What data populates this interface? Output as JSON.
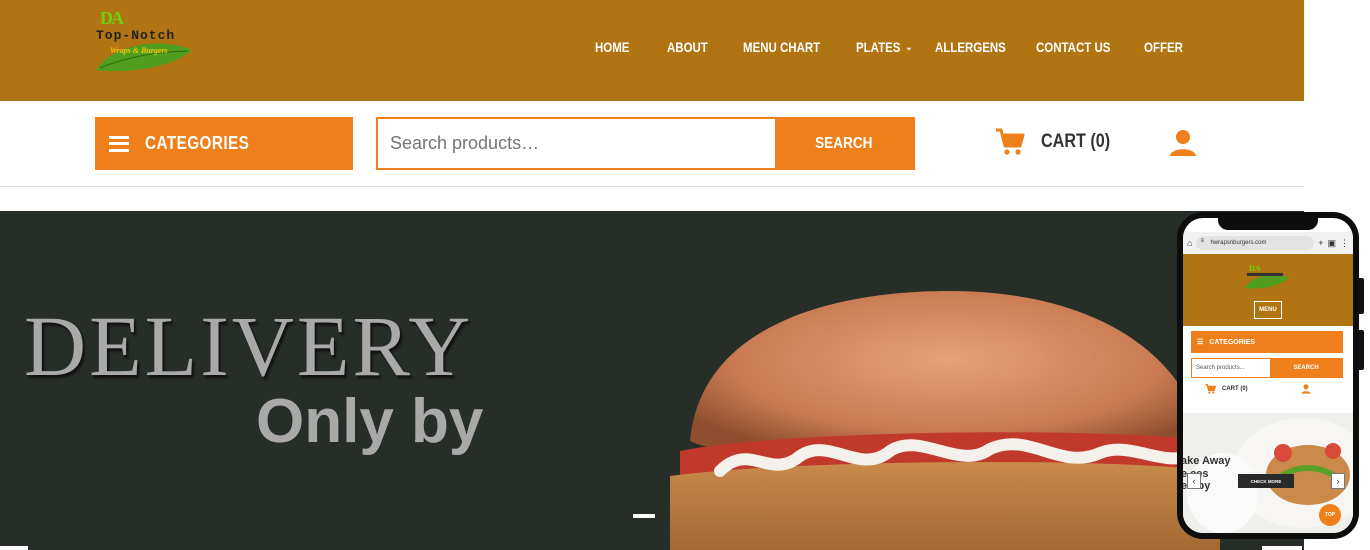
{
  "header": {
    "logo": {
      "monogram": "DA",
      "brand": "Top-Notch",
      "tagline": "Wraps & Burgers"
    },
    "nav": [
      {
        "label": "HOME"
      },
      {
        "label": "ABOUT"
      },
      {
        "label": "MENU CHART"
      },
      {
        "label": "PLATES",
        "has_dropdown": true
      },
      {
        "label": "ALLERGENS"
      },
      {
        "label": "CONTACT US"
      },
      {
        "label": "OFFER"
      }
    ],
    "bg_color": "#b07413"
  },
  "toolbar": {
    "categories_label": "CATEGORIES",
    "search_placeholder": "Search products…",
    "search_button": "SEARCH",
    "cart_label": "CART (0)",
    "accent_color": "#ef7f1a"
  },
  "hero": {
    "title": "DELIVERY",
    "subtitle": "Only by",
    "bg_color": "#272d27"
  },
  "phone_preview": {
    "url": "hwrapsnburgers.com",
    "menu_button": "MENU",
    "categories_label": "CATEGORIES",
    "search_placeholder": "Search products...",
    "search_button": "SEARCH",
    "cart_label": "CART (0)",
    "hero_text": [
      "ake Away",
      "e ces",
      "earby"
    ],
    "check_more": "CHECK MORE",
    "top_button": "TOP",
    "prev_arrow": "‹",
    "next_arrow": "›"
  }
}
